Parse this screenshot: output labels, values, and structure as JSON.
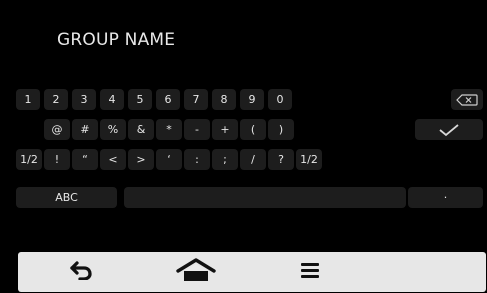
{
  "title": "GROUP NAME",
  "keyboard": {
    "row1": [
      "1",
      "2",
      "3",
      "4",
      "5",
      "6",
      "7",
      "8",
      "9",
      "0"
    ],
    "row2": [
      "@",
      "#",
      "%",
      "&",
      "*",
      "-",
      "+",
      "(",
      ")"
    ],
    "row3": [
      "1/2",
      "!",
      "“",
      "<",
      ">",
      "‘",
      ":",
      ";",
      "/",
      "?",
      "1/2"
    ],
    "row4_left": "ABC",
    "row4_right": "·"
  },
  "icons": {
    "backspace": "backspace-icon",
    "confirm": "checkmark-icon",
    "back": "back-arrow-icon",
    "home": "home-icon",
    "menu": "menu-icon"
  }
}
